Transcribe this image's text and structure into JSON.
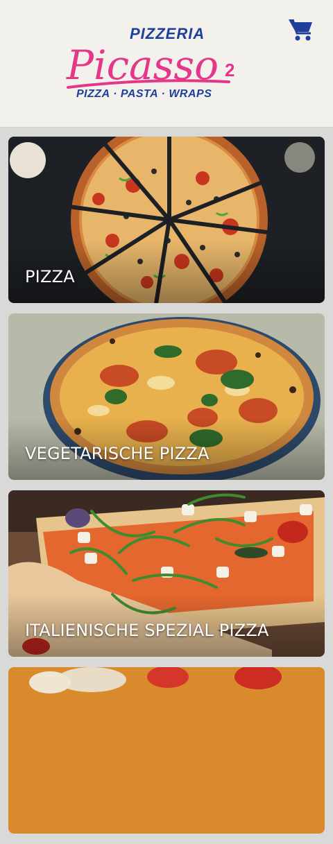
{
  "brand": {
    "line1": "PIZZERIA",
    "script": "Picasso",
    "number": "2",
    "tagline": "PIZZA · PASTA · WRAPS",
    "blue": "#1f3f9b",
    "pink": "#e4378a"
  },
  "cart": {
    "icon": "cart-icon",
    "color": "#1f3f9b"
  },
  "categories": [
    {
      "label": "PIZZA"
    },
    {
      "label": "VEGETARISCHE PIZZA"
    },
    {
      "label": "ITALIENISCHE SPEZIAL PIZZA"
    },
    {
      "label": ""
    }
  ]
}
